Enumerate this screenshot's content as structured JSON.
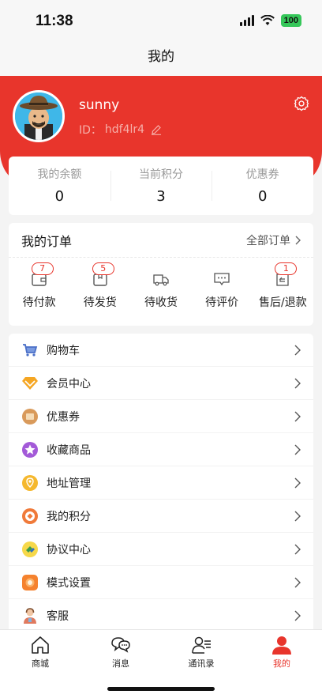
{
  "status_bar": {
    "time": "11:38",
    "battery": "100"
  },
  "nav": {
    "title": "我的"
  },
  "profile": {
    "username": "sunny",
    "id_label": "ID：",
    "id_value": "hdf4lr4"
  },
  "stats": [
    {
      "label": "我的余额",
      "value": "0"
    },
    {
      "label": "当前积分",
      "value": "3"
    },
    {
      "label": "优惠券",
      "value": "0"
    }
  ],
  "orders": {
    "title": "我的订单",
    "all_label": "全部订单",
    "items": [
      {
        "label": "待付款",
        "badge": "7",
        "icon": "wallet-icon"
      },
      {
        "label": "待发货",
        "badge": "5",
        "icon": "box-icon"
      },
      {
        "label": "待收货",
        "badge": "",
        "icon": "truck-icon"
      },
      {
        "label": "待评价",
        "badge": "",
        "icon": "comment-icon"
      },
      {
        "label": "售后/退款",
        "badge": "1",
        "icon": "refund-icon"
      }
    ]
  },
  "menu": [
    {
      "label": "购物车",
      "icon": "cart-icon",
      "color": "#4a6fc7"
    },
    {
      "label": "会员中心",
      "icon": "diamond-icon",
      "color": "#f5a623"
    },
    {
      "label": "优惠券",
      "icon": "coupon-icon",
      "color": "#d99a5b"
    },
    {
      "label": "收藏商品",
      "icon": "star-icon",
      "color": "#a35ad8"
    },
    {
      "label": "地址管理",
      "icon": "location-icon",
      "color": "#f5b82e"
    },
    {
      "label": "我的积分",
      "icon": "points-icon",
      "color": "#f07a3a"
    },
    {
      "label": "协议中心",
      "icon": "agreement-icon",
      "color": "#3a9b4a"
    },
    {
      "label": "模式设置",
      "icon": "mode-icon",
      "color": "#f5822e"
    },
    {
      "label": "客服",
      "icon": "customer-service-icon",
      "color": "#e07a5f"
    }
  ],
  "tabs": [
    {
      "label": "商城",
      "icon": "home-icon",
      "active": false
    },
    {
      "label": "消息",
      "icon": "message-icon",
      "active": false
    },
    {
      "label": "通讯录",
      "icon": "contacts-icon",
      "active": false
    },
    {
      "label": "我的",
      "icon": "profile-icon",
      "active": true
    }
  ],
  "colors": {
    "brand_red": "#e8352c",
    "battery_green": "#35c759"
  }
}
